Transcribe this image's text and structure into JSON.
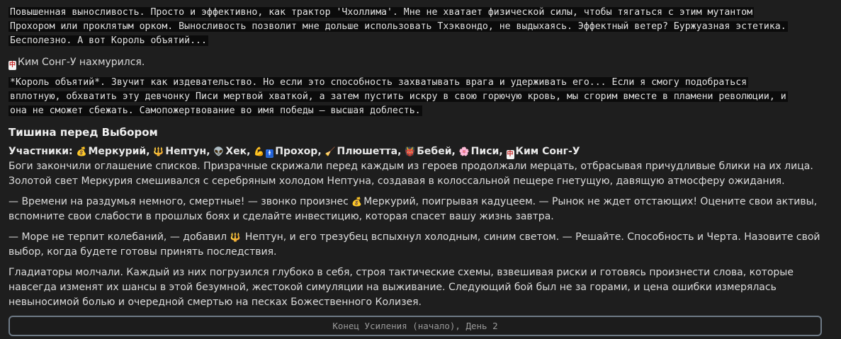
{
  "block1": {
    "line1": "Повышенная выносливость. Просто и эффективно, как трактор 'Чхоллима'. Мне не хватает физической силы, чтобы тягаться с этим мутантом",
    "line2": "Прохором или проклятым орком. Выносливость позволит мне дольше использовать Тхэквондо, не выдыхаясь. Эффектный ветер? Буржуазная эстетика.",
    "line3": "Бесполезно. А вот Король объятий..."
  },
  "kim_frown": {
    "icon": "mahjong-red-dragon-icon",
    "text": "Ким Сонг-У нахмурился."
  },
  "block2": {
    "line1": "*Король объятий*. Звучит как издевательство. Но если это способность захватывать врага и удерживать его... Если я смогу подобраться",
    "line2": "вплотную, обхватить эту девчонку Писи мертвой хваткой, а затем пустить искру в свою горючую кровь, мы сгорим вместе в пламени революции, и",
    "line3": "она не сможет сбежать. Самопожертвование во имя победы — высшая доблесть."
  },
  "section": {
    "title": "Тишина перед Выбором"
  },
  "participants": {
    "label": "Участники:",
    "items": [
      {
        "icon": "money-bag-icon",
        "glyph": "💰",
        "name": "Меркурий"
      },
      {
        "icon": "trident-icon",
        "glyph": "🔱",
        "name": "Нептун"
      },
      {
        "icon": "alien-icon",
        "glyph": "👽",
        "name": "Хек"
      },
      {
        "icon": "flexed-biceps-icon",
        "glyph": "💪",
        "name": ""
      },
      {
        "icon": "mens-room-icon",
        "glyph": "🚹",
        "name": "Прохор"
      },
      {
        "icon": "broom-icon",
        "glyph": "🧹",
        "name": "Плюшетта"
      },
      {
        "icon": "ogre-icon",
        "glyph": "👹",
        "name": "Бебей"
      },
      {
        "icon": "blossom-icon",
        "glyph": "🌸",
        "name": "Писи"
      },
      {
        "icon": "mahjong-red-dragon-icon",
        "glyph": "🀄",
        "name": "Ким Сонг-У"
      }
    ]
  },
  "story": {
    "p1": "Боги закончили оглашение списков. Призрачные скрижали перед каждым из героев продолжали мерцать, отбрасывая причудливые блики на их лица. Золотой свет Меркурия смешивался с серебряным холодом Нептуна, создавая в колоссальной пещере гнетущую, давящую атмосферу ожидания.",
    "p2_before": "— Времени на раздумья немного, смертные! — звонко произнес ",
    "p2_name": "Меркурий",
    "p2_after": ", поигрывая кадуцеем. — Рынок не ждет отстающих! Оцените свои активы, вспомните свои слабости в прошлых боях и сделайте инвестицию, которая спасет вашу жизнь завтра.",
    "p3_before": "— Море не терпит колебаний, — добавил ",
    "p3_name": "Нептун",
    "p3_after": ", и его трезубец вспыхнул холодным, синим светом. — Решайте. Способность и Черта. Назовите свой выбор, когда будете готовы принять последствия.",
    "p4": "Гладиаторы молчали. Каждый из них погрузился глубоко в себя, строя тактические схемы, взвешивая риски и готовясь произнести слова, которые навсегда изменят их шансы в этой безумной, жестокой симуляции на выживание. Следующий бой был не за горами, и цена ошибки измерялась невыносимой болью и очередной смертью на песках Божественного Колизея."
  },
  "footer": {
    "label": "Конец Усиления (начало), День 2"
  },
  "colors": {
    "background": "#1e1e1e",
    "code_highlight": "#0b0b0b",
    "footer_border": "#6e7a86"
  }
}
